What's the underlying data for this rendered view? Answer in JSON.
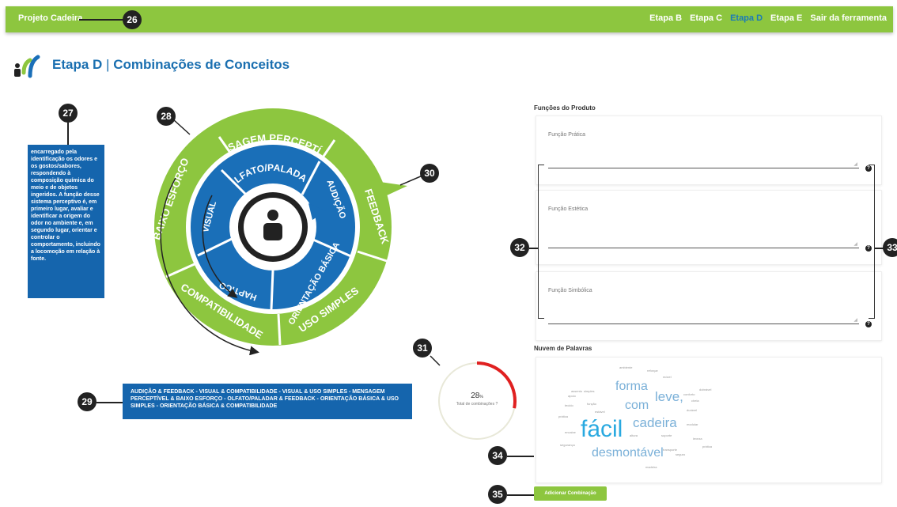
{
  "header": {
    "brand": "Projeto Cadeira",
    "nav": [
      "Etapa B",
      "Etapa C",
      "Etapa D",
      "Etapa E",
      "Sair da ferramenta"
    ],
    "active_index": 2,
    "bg_color": "#8dc63f",
    "active_color": "#1a7ab8"
  },
  "page": {
    "title_main": "Etapa D",
    "title_sep": "|",
    "title_sub": "Combinações de Conceitos"
  },
  "markers": [
    "26",
    "27",
    "28",
    "29",
    "30",
    "31",
    "32",
    "33",
    "34",
    "35"
  ],
  "tooltip": "encarregado pela identificação os odores e os gostos/sabores, respondendo à composição química do meio e de objetos ingeridos. A função desse sistema perceptivo é, em primeiro lugar, avaliar e identificar a origem do odor no ambiente e, em segundo lugar, orientar e controlar o comportamento, incluindo a locomoção em relação à fonte.",
  "wheel": {
    "outer": [
      "MENSAGEM PERCEPTÍVEL",
      "FEEDBACK",
      "USO SIMPLES",
      "COMPATIBILIDADE",
      "BAIXO ESFORÇO"
    ],
    "inner": [
      "OLFATO/PALADAR",
      "AUDIÇÃO",
      "ORIENTAÇÃO BÁSICA",
      "HAPTICO",
      "VISUAL"
    ],
    "outer_color": "#8dc63f",
    "inner_color": "#1a6fb8",
    "center_icon": "person-icon"
  },
  "combinations_text": "AUDIÇÃO & FEEDBACK - VISUAL & COMPATIBILIDADE - VISUAL & USO SIMPLES - MENSAGEM PERCEPTÍVEL & BAIXO ESFORÇO - OLFATO/PALADAR & FEEDBACK - ORIENTAÇÃO BÁSICA & USO SIMPLES - ORIENTAÇÃO BÁSICA & COMPATIBILIDADE",
  "counter": {
    "value": "28",
    "unit": "%",
    "label": "Total de combinações ?",
    "progress": 0.28,
    "progress_color": "#e02020"
  },
  "functions": {
    "title": "Funções do Produto",
    "items": [
      "Função Prática",
      "Função Estética",
      "Função Simbólica"
    ],
    "help": "?"
  },
  "cloud": {
    "title": "Nuvem de Palavras",
    "words": [
      "fácil",
      "desmontável",
      "cadeira",
      "forma",
      "leve,",
      "com",
      "ambiente",
      "reforçar",
      "móvel",
      "segurança",
      "apoio",
      "prática",
      "função",
      "estável",
      "leveza",
      "durável",
      "simples",
      "conforto",
      "tecido",
      "encaixe",
      "modular",
      "suporte",
      "dobrável",
      "altura",
      "transporte",
      "madeira",
      "cheia",
      "prática",
      "seguro",
      "assento"
    ]
  },
  "add_button": "Adicionar Combinação"
}
